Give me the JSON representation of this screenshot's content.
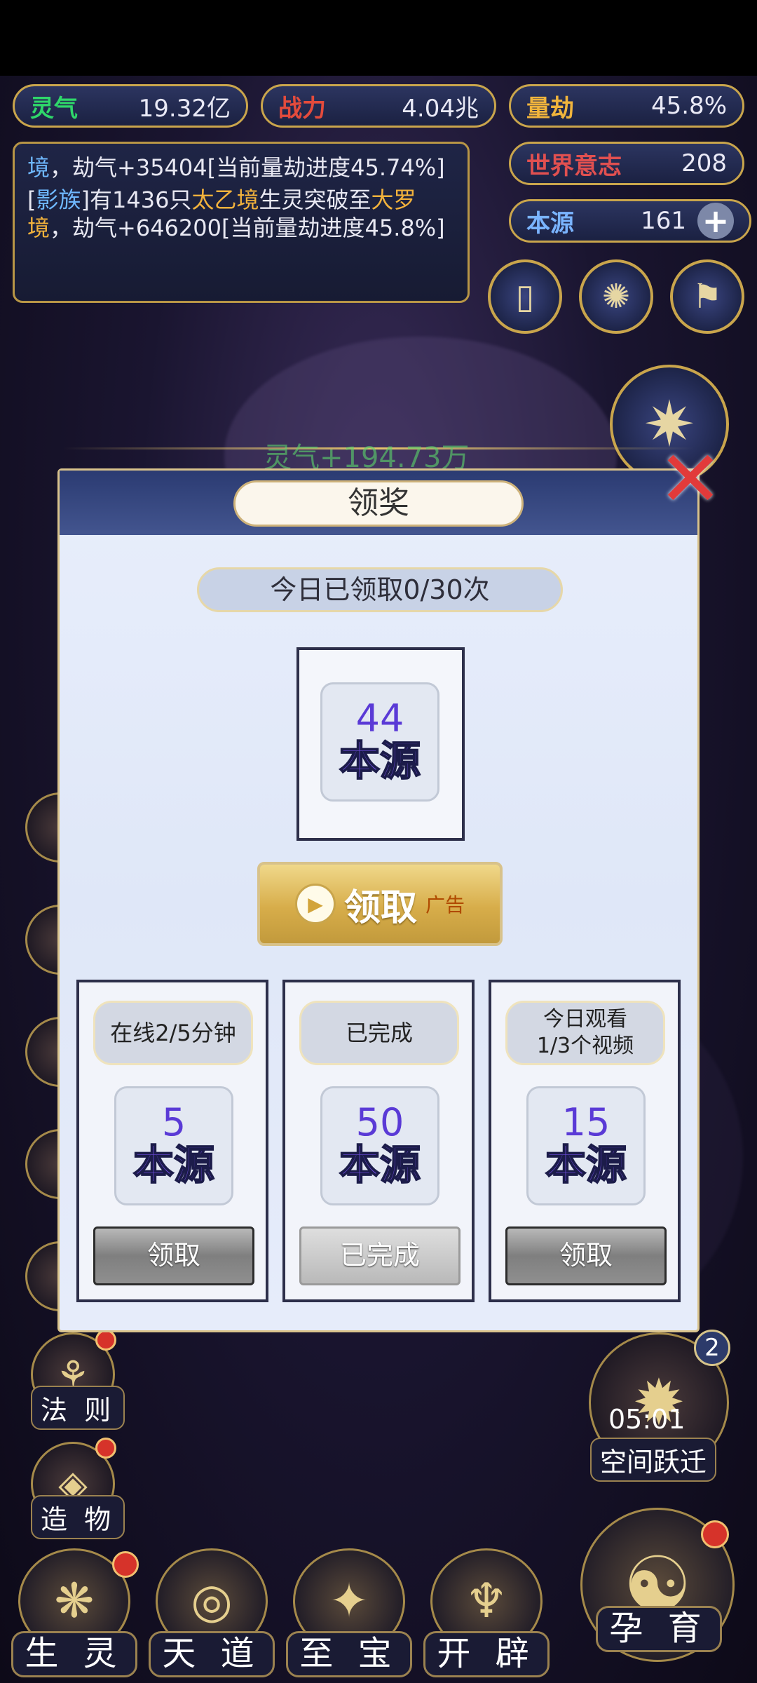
{
  "stats": [
    {
      "label": "灵气",
      "value": "19.32亿",
      "color": "#2fd76a"
    },
    {
      "label": "战力",
      "value": "4.04兆",
      "color": "#e44b3c"
    },
    {
      "label": "量劫",
      "value": "45.8%",
      "color": "#f0b43c"
    },
    {
      "label": "世界意志",
      "value": "208",
      "color": "#e15050"
    },
    {
      "label": "本源",
      "value": "161",
      "color": "#7ab4ff"
    }
  ],
  "log": {
    "line1_a": "境",
    "line1_b": "，劫气+35404[当前量劫进度45.74%]",
    "line2_a": "[",
    "line2_b": "影族",
    "line2_c": "]有1436只",
    "line2_d": "太乙境",
    "line2_e": "生灵突破至",
    "line2_f": "大罗境",
    "line2_g": "，劫气+646200[当前量劫进度45.8%]"
  },
  "floating_gain": "灵气+194.73万",
  "dialog": {
    "title": "领奖",
    "count_text": "今日已领取0/30次",
    "main_reward": {
      "amount": "44",
      "name": "本源"
    },
    "claim_ad_button": {
      "label": "领取",
      "tag": "广告"
    },
    "tasks": [
      {
        "title": "在线2/5分钟",
        "amount": "5",
        "name": "本源",
        "button": "领取",
        "done": false
      },
      {
        "title": "已完成",
        "amount": "50",
        "name": "本源",
        "button": "已完成",
        "done": true
      },
      {
        "title": "今日观看\n1/3个视频",
        "amount": "15",
        "name": "本源",
        "button": "领取",
        "done": false
      }
    ]
  },
  "left_side": [
    "法 则",
    "造 物"
  ],
  "right_side": {
    "badge": "2",
    "timer": "05:01",
    "label": "空间跃迁"
  },
  "bottom_nav": [
    "生 灵",
    "天 道",
    "至 宝",
    "开 辟",
    "孕 育"
  ],
  "icons": [
    "plus-icon",
    "card-icon",
    "portal-icon",
    "flag-icon",
    "close-icon",
    "play-icon"
  ]
}
